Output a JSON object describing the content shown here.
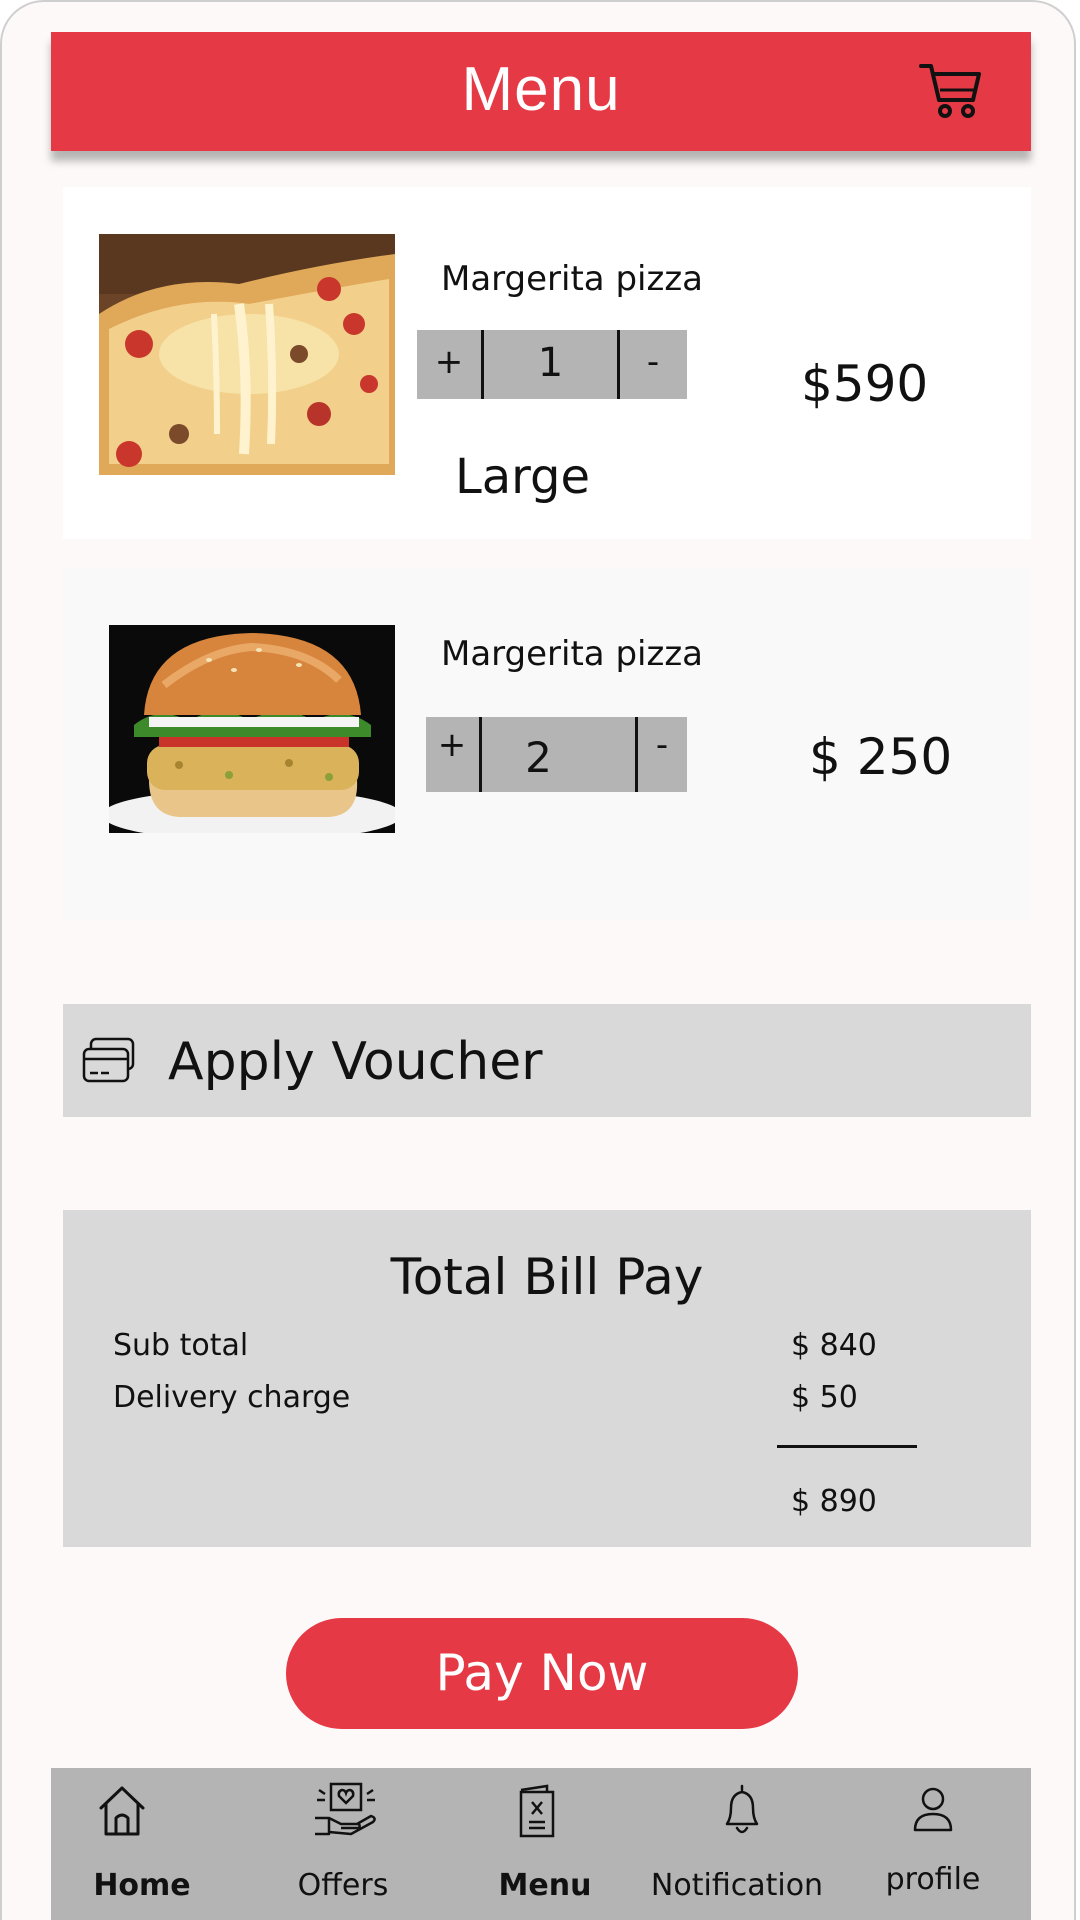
{
  "header": {
    "title": "Menu",
    "cart_icon": "cart-icon"
  },
  "items": [
    {
      "name": "Margerita pizza",
      "quantity": "1",
      "plus": "+",
      "minus": "-",
      "price": "$590",
      "size": "Large",
      "image": "pizza-photo"
    },
    {
      "name": "Margerita pizza",
      "quantity": "2",
      "plus": "+",
      "minus": "-",
      "price": "$ 250",
      "image": "burger-photo"
    }
  ],
  "voucher": {
    "label": "Apply Voucher",
    "icon": "voucher-card-icon"
  },
  "bill": {
    "title": "Total Bill Pay",
    "rows": [
      {
        "label": "Sub total",
        "value": "$ 840"
      },
      {
        "label": "Delivery charge",
        "value": "$ 50"
      }
    ],
    "total": "$ 890"
  },
  "pay_button": {
    "label": "Pay Now"
  },
  "nav": {
    "items": [
      {
        "label": "Home",
        "icon": "home-icon",
        "active": true
      },
      {
        "label": "Offers",
        "icon": "offers-icon",
        "active": false
      },
      {
        "label": "Menu",
        "icon": "menu-book-icon",
        "active": true
      },
      {
        "label": "Notification",
        "icon": "bell-icon",
        "active": false
      },
      {
        "label": "profile",
        "icon": "user-icon",
        "active": false
      }
    ]
  },
  "colors": {
    "accent": "#e63946",
    "panel_gray": "#d9d9d9",
    "nav_gray": "#b4b4b4"
  }
}
